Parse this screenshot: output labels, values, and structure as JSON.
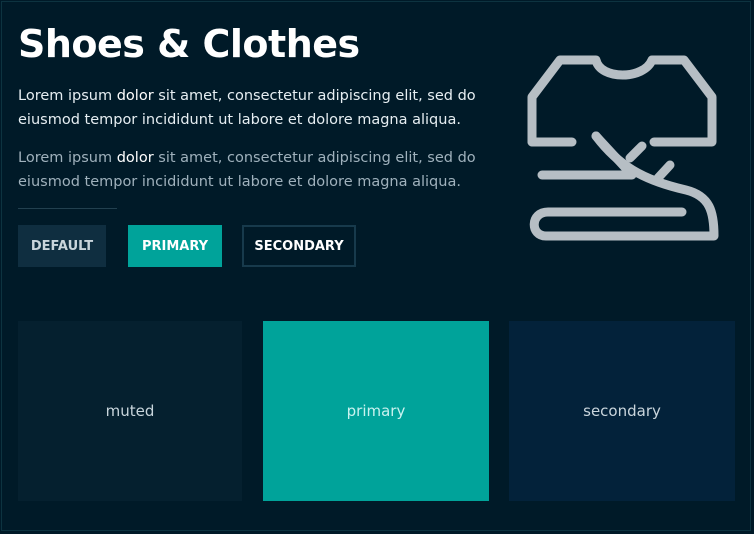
{
  "header": {
    "title": "Shoes & Clothes"
  },
  "paragraphs": [
    {
      "before": "Lorem ipsum ",
      "highlight": "dolor",
      "after": " sit amet, consectetur adipiscing elit, sed do eiusmod tempor incididunt ut labore et dolore magna aliqua."
    },
    {
      "before": "Lorem ipsum ",
      "highlight": "dolor",
      "after": " sit amet, consectetur adipiscing elit, sed do eiusmod tempor incididunt ut labore et dolore magna aliqua."
    }
  ],
  "buttons": {
    "default_label": "DEFAULT",
    "primary_label": "PRIMARY",
    "secondary_label": "SECONDARY"
  },
  "cards": [
    {
      "label": "muted"
    },
    {
      "label": "primary"
    },
    {
      "label": "secondary"
    }
  ],
  "icon": {
    "name": "shirt-and-shoe-icon"
  },
  "colors": {
    "background": "#001a28",
    "primary": "#00a39a",
    "muted": "#05202f",
    "secondary": "#03223a",
    "icon": "#b6bec4"
  }
}
